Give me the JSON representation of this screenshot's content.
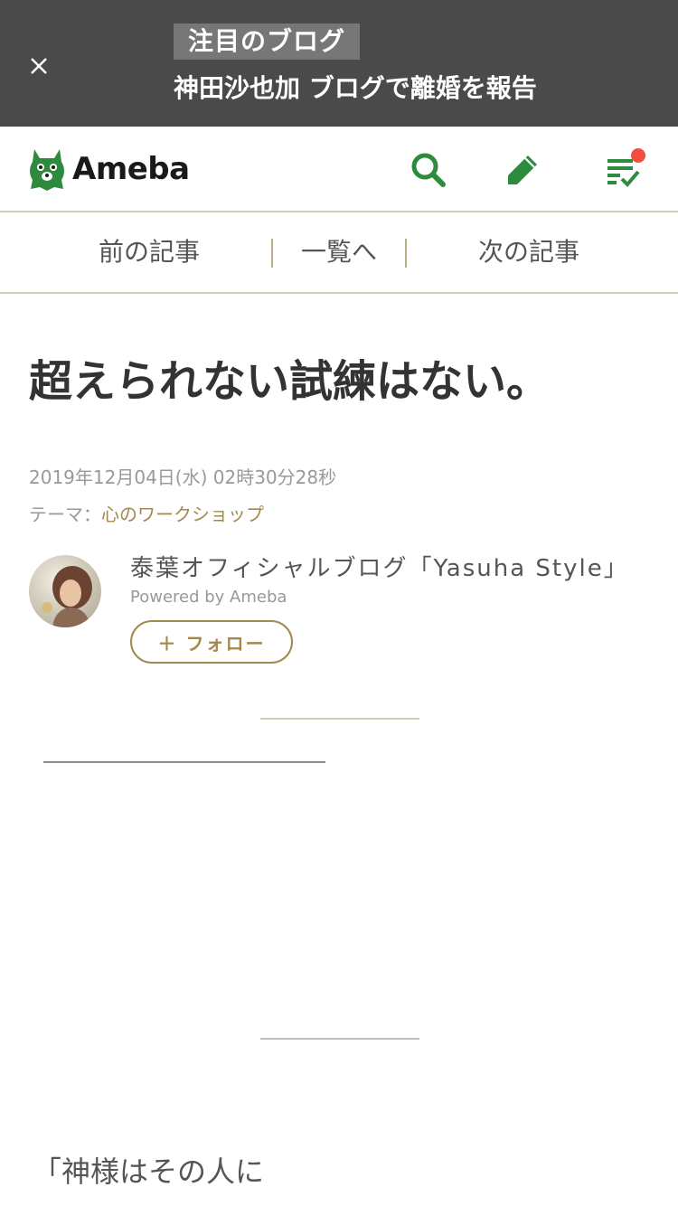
{
  "notice": {
    "badge": "注目のブログ",
    "title": "神田沙也加 ブログで離婚を報告"
  },
  "header": {
    "logo_text": "Ameba",
    "icons": [
      "search-icon",
      "pencil-icon",
      "feed-check-icon"
    ],
    "brand_color": "#2e8b3d",
    "notification_color": "#f0513f"
  },
  "article_nav": {
    "prev": "前の記事",
    "list": "一覧へ",
    "next": "次の記事"
  },
  "article": {
    "title": "超えられない試練はない。",
    "date": "2019年12月04日(水) 02時30分28秒",
    "theme_label": "テーマ：",
    "theme": "心のワークショップ",
    "body_start": "「神様はその人に"
  },
  "author": {
    "blog_name": "泰葉オフィシャルブログ「Yasuha Style」",
    "powered_by": "Powered by Ameba",
    "follow_label": "＋ フォロー"
  },
  "colors": {
    "accent_gold": "#a4894f",
    "banner_bg": "#4a4a4a"
  }
}
